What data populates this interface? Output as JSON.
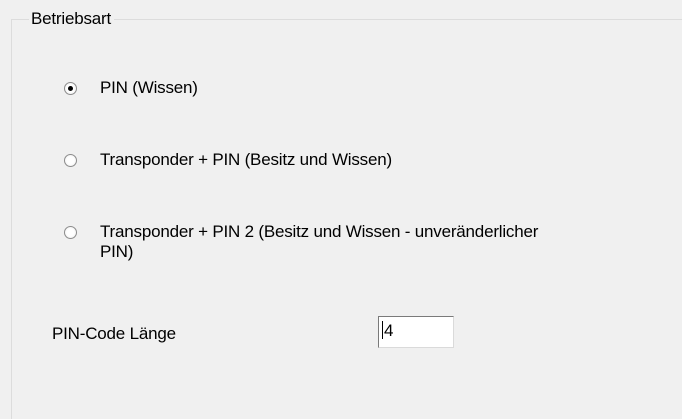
{
  "groupbox": {
    "title": "Betriebsart"
  },
  "options": [
    {
      "label": "PIN (Wissen)",
      "checked": true
    },
    {
      "label": "Transponder + PIN (Besitz und Wissen)",
      "checked": false
    },
    {
      "label": "Transponder + PIN 2 (Besitz und Wissen - unveränderlicher PIN)",
      "checked": false
    }
  ],
  "pin_length": {
    "label": "PIN-Code Länge",
    "value": "4"
  }
}
